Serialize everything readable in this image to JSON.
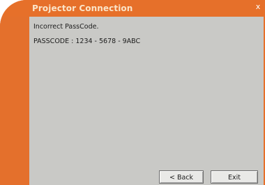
{
  "window": {
    "title": "Projector Connection",
    "close_glyph": "x"
  },
  "message": {
    "line1": "Incorrect PassCode.",
    "line2": "PASSCODE : 1234 - 5678 - 9ABC"
  },
  "buttons": {
    "back_label": "< Back",
    "exit_label": "Exit"
  },
  "colors": {
    "frame_orange": "#e6702a",
    "content_gray": "#c9c9c6"
  }
}
